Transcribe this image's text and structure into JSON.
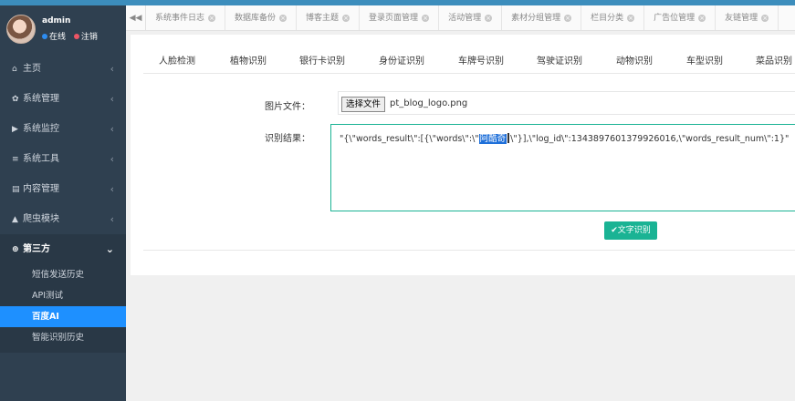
{
  "user": {
    "name": "admin",
    "status_online": "在线",
    "status_logout": "注销"
  },
  "sidebar": {
    "items": [
      {
        "label": "主页",
        "icon": "home-icon"
      },
      {
        "label": "系统管理",
        "icon": "gear-icon"
      },
      {
        "label": "系统监控",
        "icon": "video-icon"
      },
      {
        "label": "系统工具",
        "icon": "list-icon"
      },
      {
        "label": "内容管理",
        "icon": "newspaper-icon"
      },
      {
        "label": "爬虫模块",
        "icon": "bank-icon"
      },
      {
        "label": "第三方",
        "icon": "globe-icon"
      }
    ],
    "subitems": [
      {
        "label": "短信发送历史"
      },
      {
        "label": "API测试"
      },
      {
        "label": "百度AI"
      },
      {
        "label": "智能识别历史"
      }
    ]
  },
  "tabs": [
    "系统事件日志",
    "数据库备份",
    "博客主题",
    "登录页面管理",
    "活动管理",
    "素材分组管理",
    "栏目分类",
    "广告位管理",
    "友链管理"
  ],
  "subtabs": [
    "人脸检测",
    "植物识别",
    "银行卡识别",
    "身份证识别",
    "车牌号识别",
    "驾驶证识别",
    "动物识别",
    "车型识别",
    "菜品识别"
  ],
  "form": {
    "file_label": "图片文件：",
    "file_button": "选择文件",
    "file_name": "pt_blog_logo.png",
    "result_label": "识别结果：",
    "result_prefix": "\"{\\\"words_result\\\":[{\\\"words\\\":\\\"",
    "result_selected": "阿酷奇",
    "result_suffix": "\\\"}],\\\"log_id\\\":1343897601379926016,\\\"words_result_num\\\":1}\"",
    "ocr_button": "✔文字识别"
  },
  "colors": {
    "accent": "#1ab394",
    "sidebar": "#2f4050",
    "active": "#1e90ff"
  }
}
